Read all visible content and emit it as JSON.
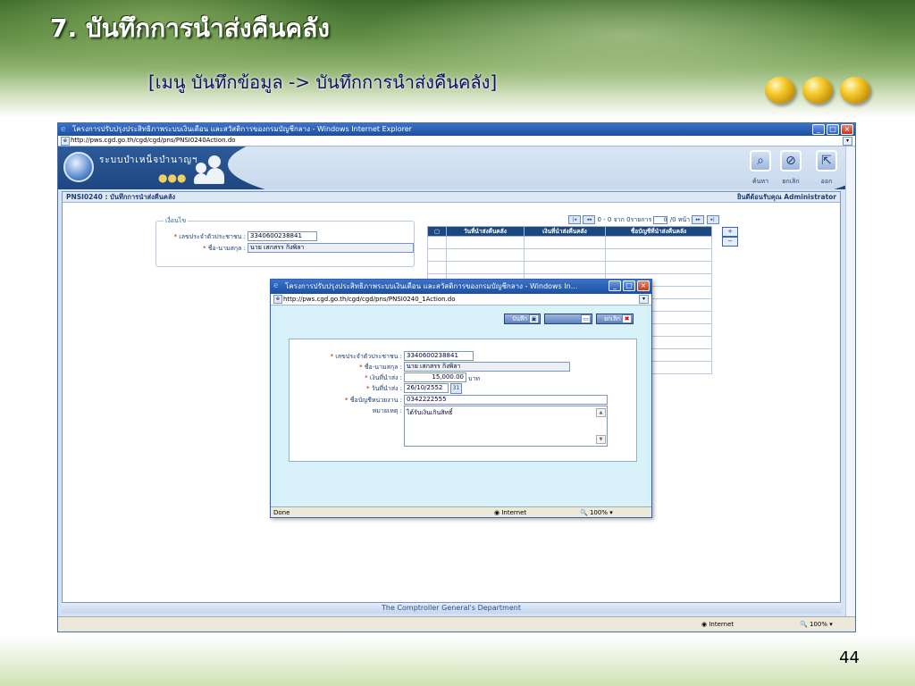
{
  "slide": {
    "title": "7. บันทึกการนำส่งคืนคลัง",
    "subtitle": "[เมนู บันทึกข้อมูล -> บันทึกการนำส่งคืนคลัง]",
    "page_number": "44"
  },
  "browser": {
    "title": "โครงการปรับปรุงประสิทธิภาพระบบเงินเดือน และสวัสดิการของกรมบัญชีกลาง - Windows Internet Explorer",
    "url": "http://pws.cgd.go.th/cgd/cgd/pns/PNSI0240Action.do",
    "status_zone": "Internet",
    "zoom": "100%"
  },
  "app": {
    "name": "ระบบบำเหน็จบำนาญฯ",
    "toolbar": {
      "search_label": "ค้นหา",
      "cancel_label": "ยกเลิก",
      "exit_label": "ออก"
    },
    "screen_code": "PNSI0240 : บันทึกการนำส่งคืนคลัง",
    "welcome": "ยินดีต้อนรับคุณ Administrator",
    "condition_legend": "เงื่อนไข",
    "fields": {
      "citizen_id_label": "เลขประจำตัวประชาชน :",
      "citizen_id_value": "3340600238841",
      "name_label": "ชื่อ-นามสกุล :",
      "name_value": "นาย เสกสรร กิ่งพิลา"
    },
    "pager": {
      "range_text": "0 - 0 จาก 0รายการ",
      "page_input": "0",
      "total_pages": "/0 หน้า"
    },
    "grid_headers": [
      "วันที่นำส่งคืนคลัง",
      "เงินที่นำส่งคืนคลัง",
      "ชื่อบัญชีที่นำส่งคืนคลัง"
    ],
    "footer": "The Comptroller General's Department"
  },
  "popup": {
    "title": "โครงการปรับปรุงประสิทธิภาพระบบเงินเดือน และสวัสดิการของกรมบัญชีกลาง - Windows In...",
    "url": "http://pws.cgd.go.th/cgd/cgd/pns/PNSI0240_1Action.do",
    "buttons": {
      "save": "บันทึก",
      "cancel": "ยกเลิก"
    },
    "fields": {
      "citizen_id_label": "เลขประจำตัวประชาชน :",
      "citizen_id_value": "3340600238841",
      "name_label": "ชื่อ-นามสกุล :",
      "name_value": "นาย เสกสรร กิ่งพิลา",
      "amount_label": "เงินที่นำส่ง :",
      "amount_value": "15,000.00",
      "amount_unit": "บาท",
      "date_label": "วันที่นำส่ง :",
      "date_value": "26/10/2552",
      "account_label": "ชื่อบัญชีหน่วยงาน :",
      "account_value": "0342222555",
      "remark_label": "หมายเหตุ :",
      "remark_value": "ได้รับเงินเกินสิทธิ์"
    },
    "status_left": "Done",
    "status_zone": "Internet",
    "zoom": "100%"
  },
  "colors": {
    "header_green": "#5f8c44",
    "title_blue": "#1e4780",
    "required_red": "#dd0000"
  }
}
